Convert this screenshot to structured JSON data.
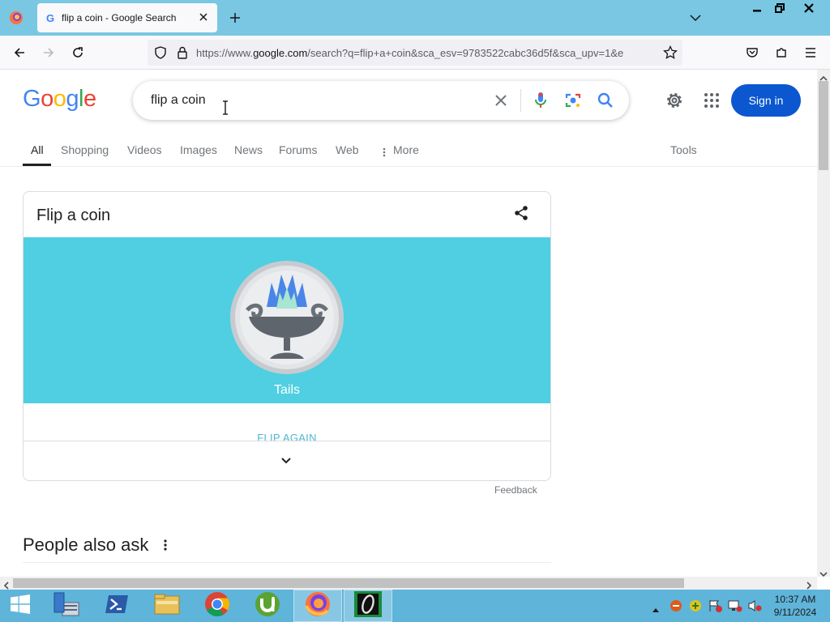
{
  "browser": {
    "tab_title": "flip a coin - Google Search",
    "url_prefix": "https://www.",
    "url_host": "google.com",
    "url_rest": "/search?q=flip+a+coin&sca_esv=9783522cabc36d5f&sca_upv=1&e"
  },
  "google": {
    "logo_text": "Google",
    "query": "flip a coin",
    "signin_label": "Sign in",
    "tabs": [
      "All",
      "Shopping",
      "Videos",
      "Images",
      "News",
      "Forums",
      "Web",
      "More"
    ],
    "tools_label": "Tools"
  },
  "coin_card": {
    "title": "Flip a coin",
    "result": "Tails",
    "flip_again": "FLIP AGAIN",
    "feedback": "Feedback"
  },
  "people_also_ask": {
    "heading": "People also ask"
  },
  "taskbar": {
    "time": "10:37 AM",
    "date": "9/11/2024"
  }
}
